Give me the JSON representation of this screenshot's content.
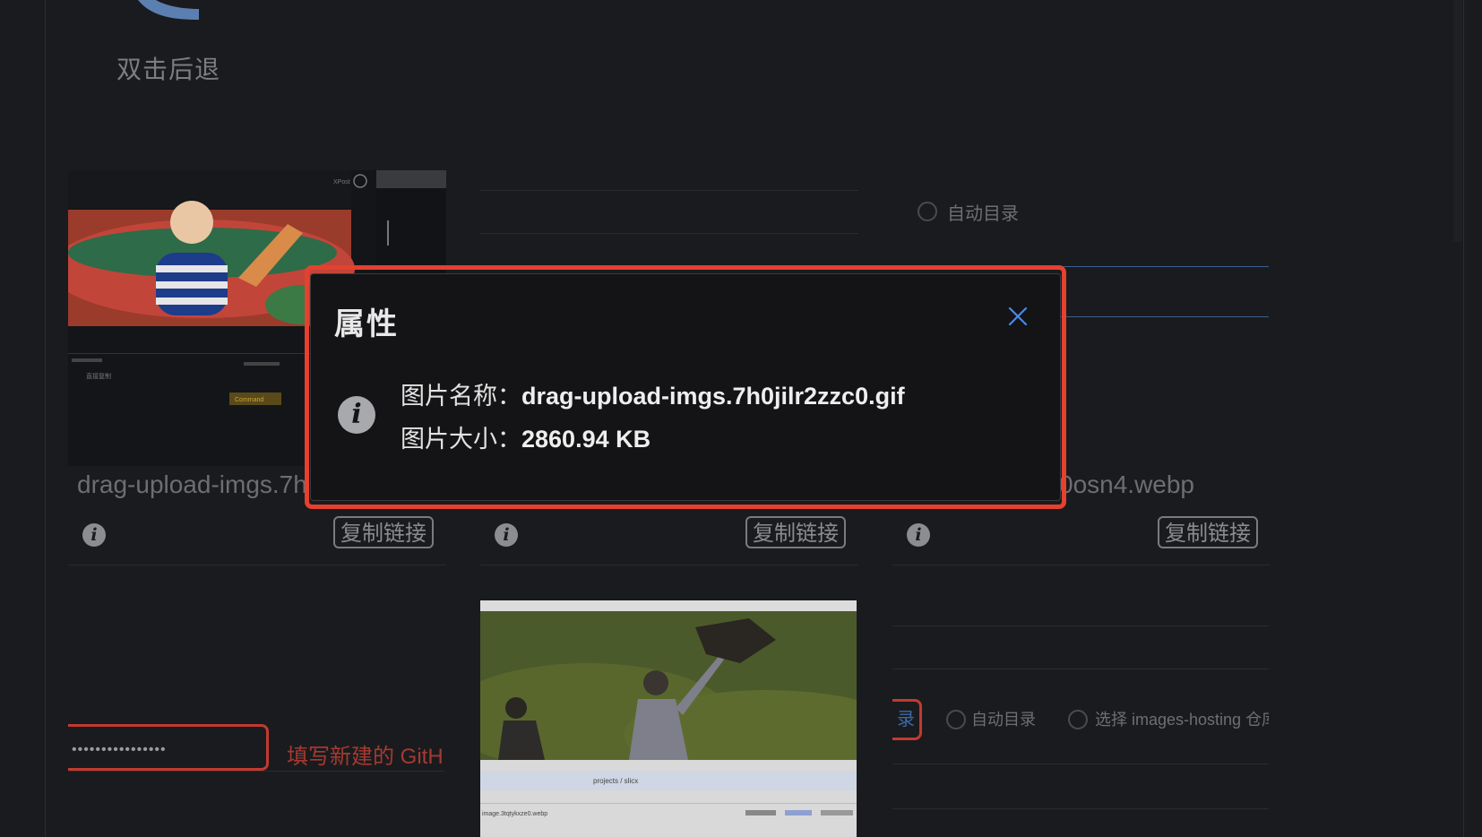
{
  "header": {
    "back_label": "双击后退"
  },
  "cards": [
    {
      "name": "drag-upload-imgs.7h",
      "copy_label": "复制链接"
    },
    {
      "name": "",
      "copy_label": "复制链接"
    },
    {
      "name": "0osn4.webp",
      "copy_label": "复制链接"
    }
  ],
  "thumb1": {
    "tiny_labels": [
      "XPost",
      "Command",
      "直接复制"
    ]
  },
  "thumb2": {
    "path_text": "projects / slicx",
    "file_text": "image.3tqtykxze0.webp"
  },
  "settings": {
    "auto_dir_label": "自动目录",
    "password_mask": "••••••••••••••••",
    "github_hint": "填写新建的 GitH",
    "dir_button_label": "录",
    "auto_dir_label_2": "自动目录",
    "select_repo_label": "选择 images-hosting 仓库"
  },
  "modal": {
    "title": "属性",
    "name_key": "图片名称：",
    "name_value": "drag-upload-imgs.7h0jilr2zzc0.gif",
    "size_key": "图片大小：",
    "size_value": "2860.94 KB"
  },
  "colors": {
    "highlight_red": "#e4412f",
    "link_blue": "#3a6aa8",
    "background": "#1a1b1e"
  },
  "icons": [
    "back-arrow-icon",
    "info-icon",
    "close-icon"
  ]
}
